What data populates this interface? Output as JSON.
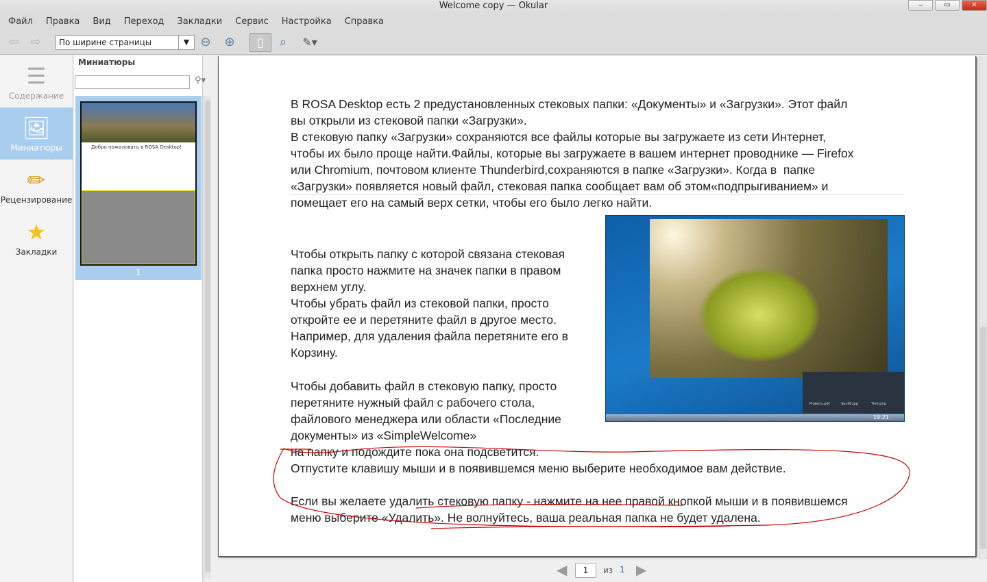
{
  "window": {
    "title": "Welcome copy — Okular",
    "min": "‒",
    "max": "▭",
    "close": "✕"
  },
  "menu": [
    "Файл",
    "Правка",
    "Вид",
    "Переход",
    "Закладки",
    "Сервис",
    "Настройка",
    "Справка"
  ],
  "toolbar": {
    "zoom_value": "По ширине страницы"
  },
  "sidebar": [
    {
      "label": "Содержание",
      "icon": "contents-icon"
    },
    {
      "label": "Миниатюры",
      "icon": "thumbnails-icon"
    },
    {
      "label": "Рецензирование",
      "icon": "pencil-icon"
    },
    {
      "label": "Закладки",
      "icon": "star-icon"
    }
  ],
  "thumbs": {
    "header": "Миниатюры",
    "search_placeholder": "",
    "page_label": "1",
    "thumb_title": "Добро пожаловать в ROSA Desktop!"
  },
  "document": {
    "para1": [
      "В ROSA Desktop есть 2 предустановленных стековых папки: «Документы» и «Загрузки». Этот файл",
      "вы открыли из стековой папки «Загрузки».",
      "В стековую папку «Загрузки» сохраняются все файлы которые вы загружаете из сети Интернет,",
      "чтобы их было проще найти.Файлы, которые вы загружаете в вашем интернет проводнике — Firefox",
      "или Chromium, почтовом клиенте Thunderbird,сохраняются в папке «Загрузки». Когда в  папке",
      "«Загрузки» появляется новый файл, стековая папка сообщает вам об этом«подпрыгиванием» и",
      "помещает его на самый верх сетки, чтобы его было легко найти."
    ],
    "para2": [
      "Чтобы открыть папку с которой связана стековая",
      "папка просто нажмите на значек папки в правом",
      "верхнем углу.",
      "Чтобы убрать файл из стековой папки, просто",
      "откройте ее и перетяните файл в другое место.",
      "Например, для удаления файла перетяните его в",
      "Корзину."
    ],
    "para3": [
      "Чтобы добавить файл в стековую папку, просто",
      "перетяните нужный файл с рабочего стола,",
      "файлового менеджера или области «Последние",
      "документы» из «SimpleWelcome»",
      "на папку и подождите пока она подсветится.",
      "Отпустите клавишу мыши и в появившемся меню выберите необходимое вам действие."
    ],
    "para4": [
      "Если вы желаете удалить стековую папку - нажмите на нее правой кнопкой мыши и в появившемся",
      "меню выберите «Удалить». Не волнуйтесь, ваша реальная папка не будет удалена."
    ],
    "screenshot_files": [
      "Projects.pdf",
      "Sunfill.jpg",
      "Tirol.png"
    ],
    "screenshot_clock": "19:21"
  },
  "nav": {
    "current_page": "1",
    "of_label": "из",
    "total_pages": "1"
  },
  "colors": {
    "annotation": "#d00000",
    "selection": "#a8cdee"
  }
}
